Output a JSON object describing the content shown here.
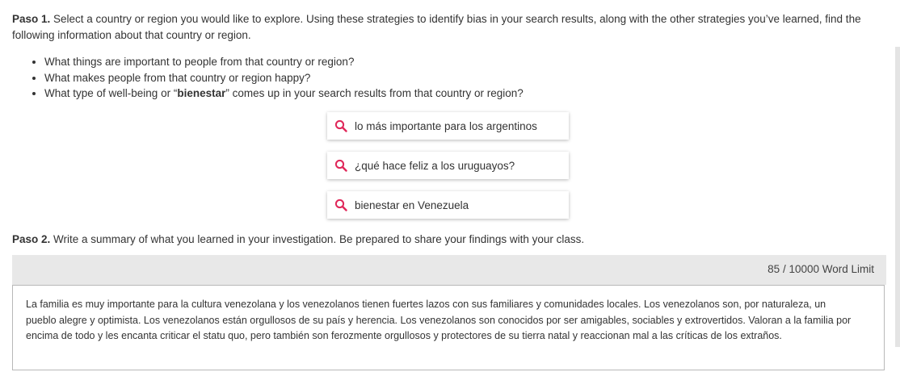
{
  "paso1": {
    "label": "Paso 1.",
    "text": " Select a country or region you would like to explore. Using these strategies to identify bias in your search results, along with the other strategies you’ve learned, find the following information about that country or region."
  },
  "questions": {
    "q1": "What things are important to people from that country or region?",
    "q2": "What makes people from that country or region happy?",
    "q3_before": "What type of well-being or “",
    "q3_bold": "bienestar",
    "q3_after": "” comes up in your search results from that country or region?"
  },
  "searches": [
    {
      "text": "lo más importante para los argentinos",
      "icon": "search-icon"
    },
    {
      "text": "¿qué hace feliz a los uruguayos?",
      "icon": "search-icon"
    },
    {
      "text": "bienestar en Venezuela",
      "icon": "search-icon"
    }
  ],
  "paso2": {
    "label": "Paso 2.",
    "text": " Write a summary of what you learned in your investigation. Be prepared to share your findings with your class."
  },
  "word_limit": {
    "text": "85 /  10000 Word Limit"
  },
  "summary": {
    "text": "La familia es muy importante para la cultura venezolana y los venezolanos tienen fuertes lazos con sus familiares y comunidades locales. Los venezolanos son, por naturaleza, un pueblo alegre y optimista. Los venezolanos están orgullosos de su país y herencia. Los venezolanos son conocidos por ser amigables, sociables y extrovertidos. Valoran a la familia por encima de todo y les encanta criticar el statu quo, pero también son ferozmente orgullosos y protectores de su tierra natal y reaccionan mal a las críticas de los extraños."
  },
  "colors": {
    "search_icon": "#e0285a",
    "limit_bar": "#e8e8e8"
  }
}
